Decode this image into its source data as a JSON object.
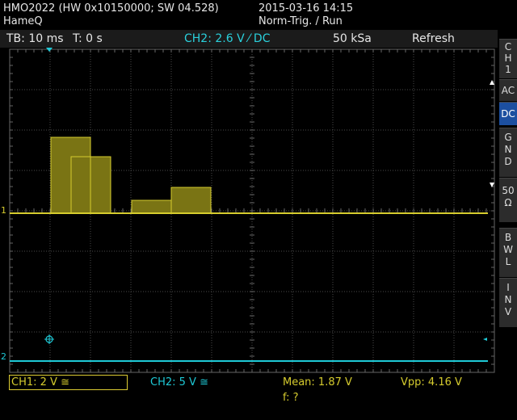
{
  "header": {
    "model_line": "HMO2022 (HW 0x10150000; SW 04.528)",
    "vendor": "HameQ",
    "datetime": "2015-03-16 14:15",
    "trigger_state": "Norm-Trig. / Run"
  },
  "status": {
    "timebase": "TB: 10 ms",
    "trigger_time": "T: 0 s",
    "trigger_src": "CH2: 2.6 V ⁄ DC",
    "sample_rate": "50 kSa",
    "mode": "Refresh"
  },
  "side_menu": {
    "channel": [
      "C",
      "H",
      "1"
    ],
    "ac": "AC",
    "dc": "DC",
    "gnd": [
      "G",
      "N",
      "D"
    ],
    "ohm": [
      "50",
      "Ω"
    ],
    "bwl": [
      "B",
      "W",
      "L"
    ],
    "inv": [
      "I",
      "N",
      "V"
    ]
  },
  "footer": {
    "ch1": "CH1: 2 V ≅",
    "ch2": "CH2: 5 V ≅",
    "mean": "Mean: 1.87 V",
    "vpp": "Vpp: 4.16 V",
    "freq": "f: ?"
  },
  "markers": {
    "ch1": "1",
    "ch2": "2"
  },
  "colors": {
    "ch1": "#d6cc2e",
    "ch2": "#1ec9d6",
    "grid": "#4a4a4a",
    "active": "#1c4fa0"
  }
}
